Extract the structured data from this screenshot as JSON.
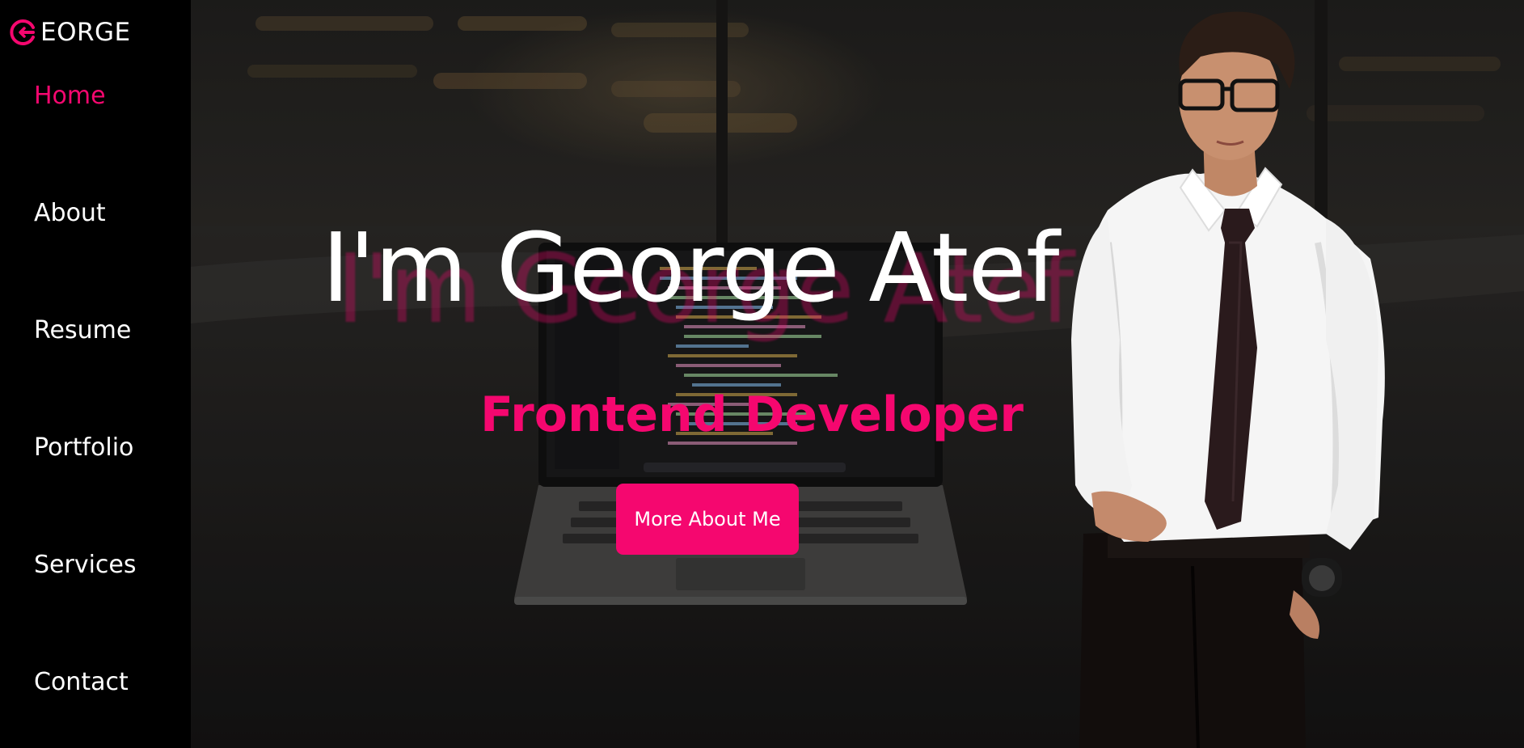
{
  "brand": {
    "logo_text": "EORGE",
    "accent": "#f5076f"
  },
  "sidebar": {
    "items": [
      {
        "label": "Home",
        "active": true
      },
      {
        "label": "About",
        "active": false
      },
      {
        "label": "Resume",
        "active": false
      },
      {
        "label": "Portfolio",
        "active": false
      },
      {
        "label": "Services",
        "active": false
      },
      {
        "label": "Contact",
        "active": false
      }
    ]
  },
  "hero": {
    "title": "I'm George Atef",
    "subtitle": "Frontend Developer",
    "button_label": "More About Me"
  },
  "colors": {
    "sidebar_bg": "#000000",
    "text": "#ffffff",
    "accent": "#f5076f"
  }
}
